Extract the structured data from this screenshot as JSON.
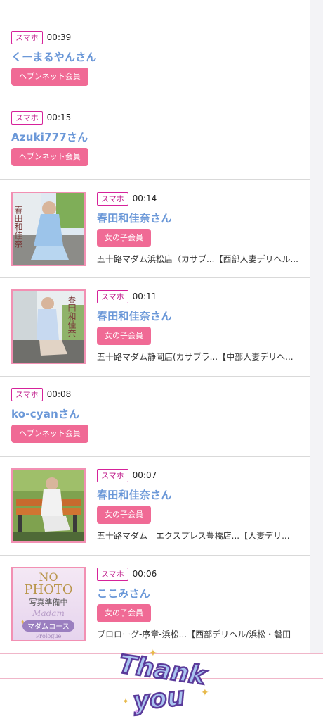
{
  "items": [
    {
      "device": "スマホ",
      "time": "00:39",
      "name": "くーまるやんさん",
      "member": "ヘブンネット会員"
    },
    {
      "device": "スマホ",
      "time": "00:15",
      "name": "Azuki777さん",
      "member": "ヘブンネット会員"
    },
    {
      "device": "スマホ",
      "time": "00:14",
      "name": "春田和佳奈さん",
      "member": "女の子会員",
      "shop": "五十路マダム浜松店（カサブ...【西部人妻デリヘル..."
    },
    {
      "device": "スマホ",
      "time": "00:11",
      "name": "春田和佳奈さん",
      "member": "女の子会員",
      "shop": "五十路マダム静岡店(カサブラ...【中部人妻デリへ..."
    },
    {
      "device": "スマホ",
      "time": "00:08",
      "name": "ko-cyanさん",
      "member": "ヘブンネット会員"
    },
    {
      "device": "スマホ",
      "time": "00:07",
      "name": "春田和佳奈さん",
      "member": "女の子会員",
      "shop": "五十路マダム　エクスプレス豊橋店...【人妻デリ..."
    },
    {
      "device": "スマホ",
      "time": "00:06",
      "name": "ここみさん",
      "member": "女の子会員",
      "shop": "プロローグ-序章-浜松...【西部デリヘル/浜松・磐田"
    }
  ],
  "thumbs": {
    "photo_vertical_text": "春田和佳奈",
    "nophoto_line1": "NO",
    "nophoto_line2": "PHOTO",
    "nophoto_line3": "写真準備中",
    "nophoto_script": "Madam",
    "nophoto_course": "マダムコース",
    "nophoto_brand": "Prologue"
  },
  "stamp": {
    "line1": "Thank",
    "line2": "you"
  },
  "colors": {
    "accent_pink": "#f06a95",
    "name_blue": "#6b98d8",
    "badge_magenta": "#d6229a"
  }
}
